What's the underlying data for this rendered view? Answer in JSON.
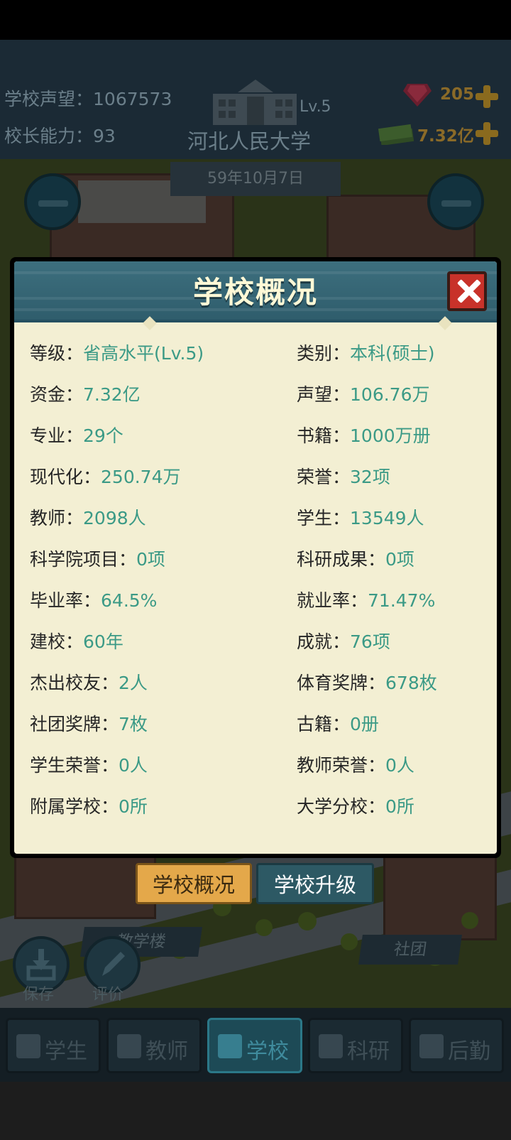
{
  "hud": {
    "prestige_label": "学校声望：",
    "prestige_value": "1067573",
    "ability_label": "校长能力：",
    "ability_value": "93",
    "level": "Lv.5",
    "school_name": "河北人民大学",
    "date": "59年10月7日",
    "gems": "205",
    "money": "7.32亿"
  },
  "modal": {
    "title": "学校概况",
    "stats": [
      {
        "label": "等级：",
        "value": "省高水平(Lv.5)"
      },
      {
        "label": "类别：",
        "value": "本科(硕士)"
      },
      {
        "label": "资金：",
        "value": "7.32亿"
      },
      {
        "label": "声望：",
        "value": "106.76万"
      },
      {
        "label": "专业：",
        "value": "29个"
      },
      {
        "label": "书籍：",
        "value": "1000万册"
      },
      {
        "label": "现代化：",
        "value": "250.74万"
      },
      {
        "label": "荣誉：",
        "value": "32项"
      },
      {
        "label": "教师：",
        "value": "2098人"
      },
      {
        "label": "学生：",
        "value": "13549人"
      },
      {
        "label": "科学院项目：",
        "value": "0项"
      },
      {
        "label": "科研成果：",
        "value": "0项"
      },
      {
        "label": "毕业率：",
        "value": "64.5%"
      },
      {
        "label": "就业率：",
        "value": "71.47%"
      },
      {
        "label": "建校：",
        "value": "60年"
      },
      {
        "label": "成就：",
        "value": "76项"
      },
      {
        "label": "杰出校友：",
        "value": "2人"
      },
      {
        "label": "体育奖牌：",
        "value": "678枚"
      },
      {
        "label": "社团奖牌：",
        "value": "7枚"
      },
      {
        "label": "古籍：",
        "value": "0册"
      },
      {
        "label": "学生荣誉：",
        "value": "0人"
      },
      {
        "label": "教师荣誉：",
        "value": "0人"
      },
      {
        "label": "附属学校：",
        "value": "0所"
      },
      {
        "label": "大学分校：",
        "value": "0所"
      }
    ]
  },
  "tabs": {
    "overview": "学校概况",
    "upgrade": "学校升级"
  },
  "city": {
    "teaching_building": "教学楼",
    "club": "社团",
    "save": "保存",
    "rate": "评价"
  },
  "nav": {
    "students": "学生",
    "teachers": "教师",
    "school": "学校",
    "research": "科研",
    "logistics": "后勤"
  }
}
